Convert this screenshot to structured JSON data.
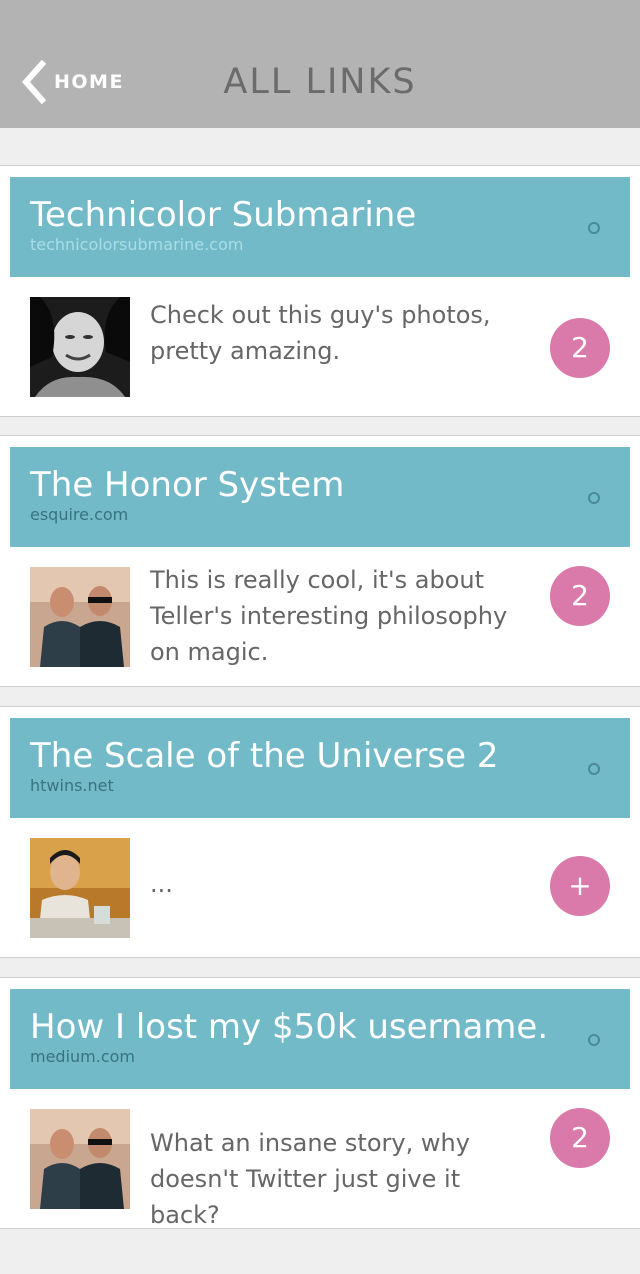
{
  "nav": {
    "back_label": "HOME",
    "title": "ALL LINKS"
  },
  "links": [
    {
      "title": "Technicolor Submarine",
      "domain": "technicolorsubmarine.com",
      "domain_color": "#a8dde6",
      "comment": "Check out this guy's photos, pretty amazing.",
      "count": "2",
      "avatar": "bw-portrait"
    },
    {
      "title": "The Honor System",
      "domain": "esquire.com",
      "domain_color": "#3a7280",
      "comment": "This is really cool, it's about Teller's interesting philosophy on magic.",
      "count": "2",
      "avatar": "two-friends-photo"
    },
    {
      "title": "The Scale of the Universe 2",
      "domain": "htwins.net",
      "domain_color": "#3a7280",
      "comment": "...",
      "count": "+",
      "avatar": "restaurant-portrait"
    },
    {
      "title": "How I lost my $50k username.",
      "domain": "medium.com",
      "domain_color": "#3a7280",
      "comment": "What an insane story, why doesn't Twitter just give it back?",
      "count": "2",
      "avatar": "two-friends-photo"
    }
  ],
  "colors": {
    "nav_bg": "#b3b3b3",
    "header_bg": "#73bac8",
    "count_bg": "#d97aab",
    "page_bg": "#efefef"
  }
}
